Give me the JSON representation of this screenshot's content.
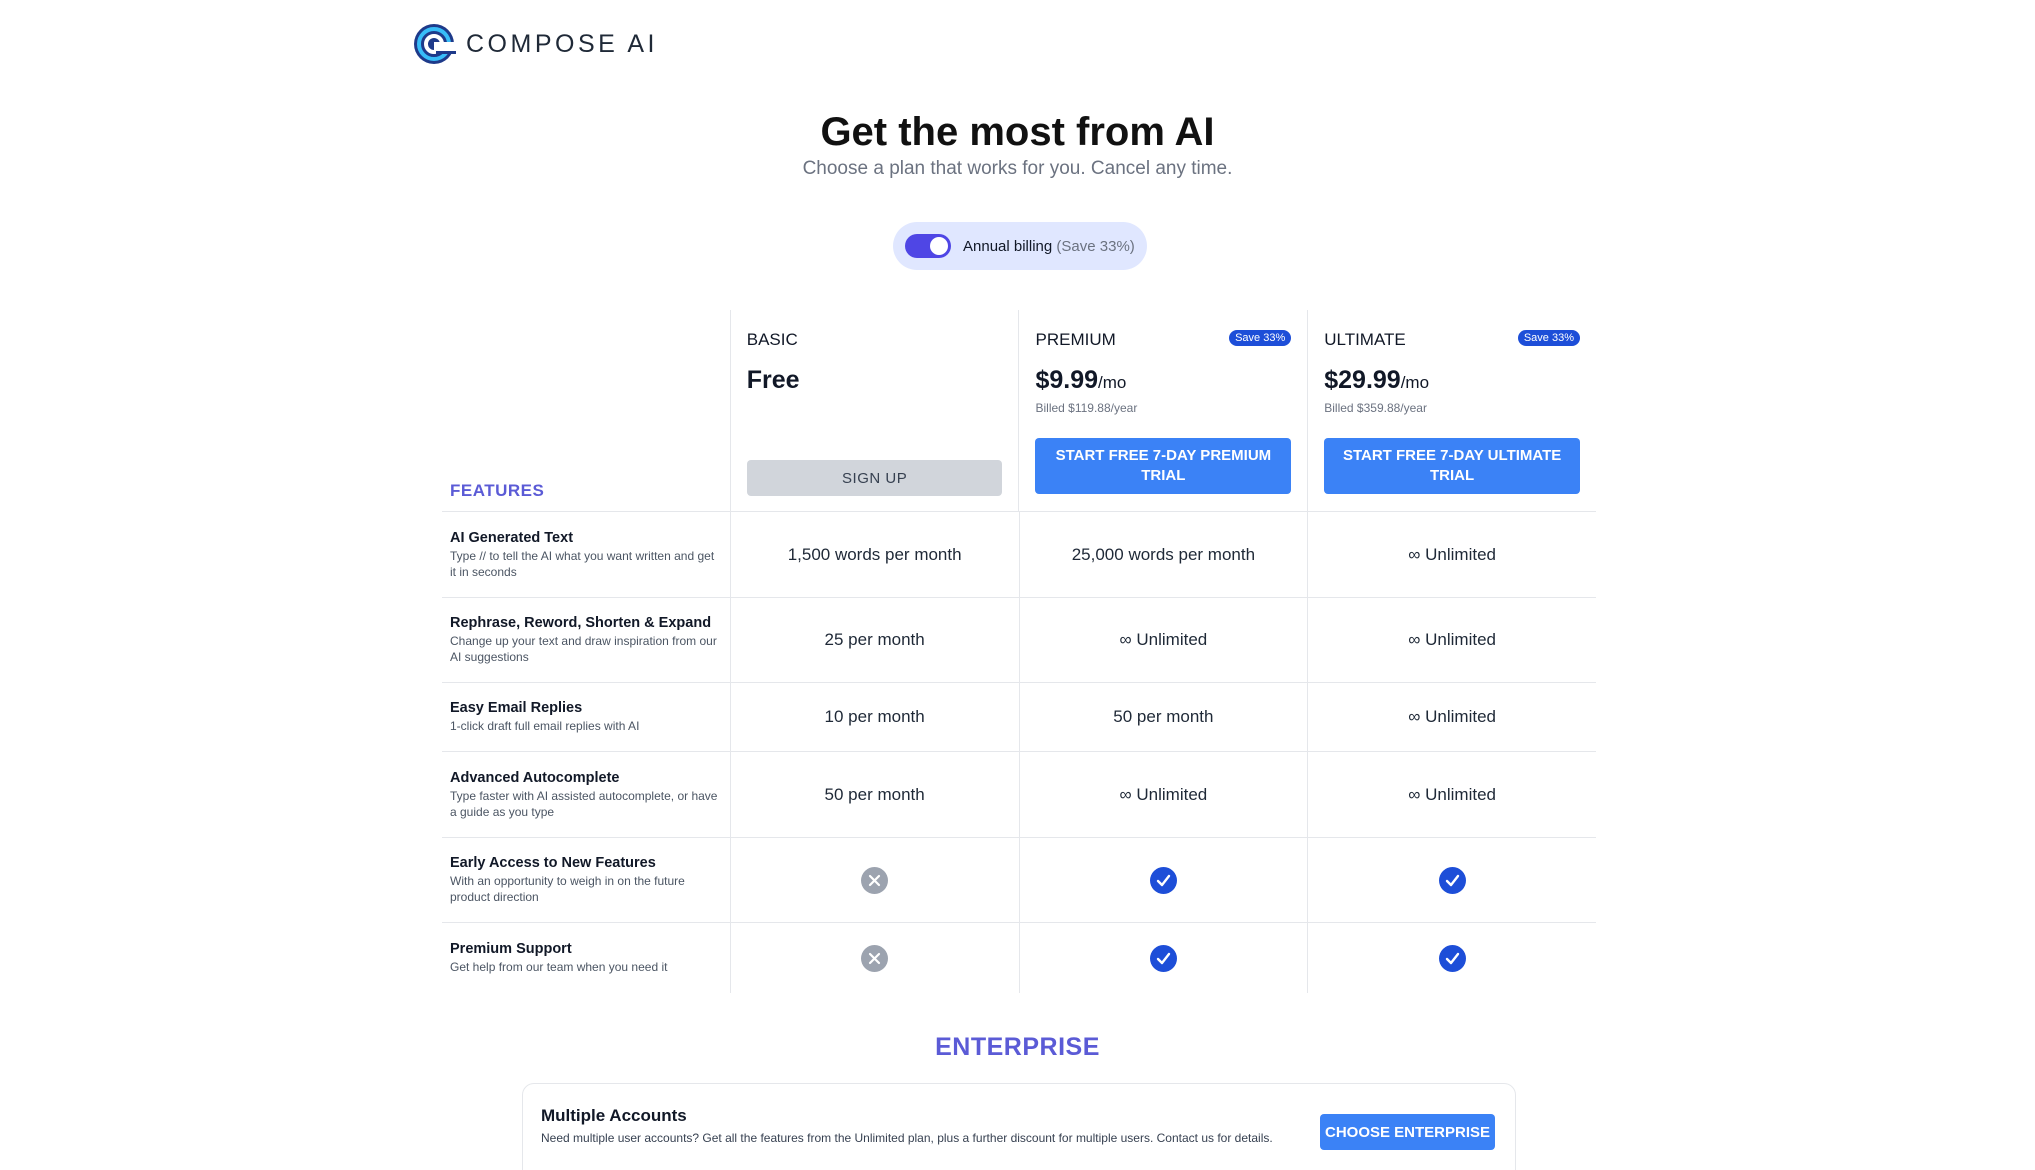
{
  "brand": {
    "name": "COMPOSE AI",
    "logo_icon": "compose-ai-logo-icon"
  },
  "hero": {
    "title": "Get the most from AI",
    "subtitle": "Choose a plan that works for you. Cancel any time."
  },
  "billing": {
    "label": "Annual billing",
    "save": "(Save 33%)",
    "enabled": true
  },
  "features_label": "FEATURES",
  "plans": [
    {
      "name": "BASIC",
      "price": "Free",
      "per": "",
      "billed": "",
      "badge": "",
      "cta": "SIGN UP"
    },
    {
      "name": "PREMIUM",
      "price": "$9.99",
      "per": "/mo",
      "billed": "Billed $119.88/year",
      "badge": "Save 33%",
      "cta": "START FREE 7-DAY PREMIUM TRIAL"
    },
    {
      "name": "ULTIMATE",
      "price": "$29.99",
      "per": "/mo",
      "billed": "Billed $359.88/year",
      "badge": "Save 33%",
      "cta": "START FREE 7-DAY ULTIMATE TRIAL"
    }
  ],
  "features": [
    {
      "title": "AI Generated Text",
      "desc": "Type // to tell the AI what you want written and get it in seconds",
      "values": [
        "1,500 words per month",
        "25,000 words per month",
        "∞ Unlimited"
      ]
    },
    {
      "title": "Rephrase, Reword, Shorten & Expand",
      "desc": "Change up your text and draw inspiration from our AI suggestions",
      "values": [
        "25 per month",
        "∞ Unlimited",
        "∞ Unlimited"
      ]
    },
    {
      "title": "Easy Email Replies",
      "desc": "1-click draft full email replies with AI",
      "values": [
        "10 per month",
        "50 per month",
        "∞ Unlimited"
      ]
    },
    {
      "title": "Advanced Autocomplete",
      "desc": "Type faster with AI assisted autocomplete, or have a guide as you type",
      "values": [
        "50 per month",
        "∞ Unlimited",
        "∞ Unlimited"
      ]
    },
    {
      "title": "Early Access to New Features",
      "desc": "With an opportunity to weigh in on the future product direction",
      "included": [
        false,
        true,
        true
      ]
    },
    {
      "title": "Premium Support",
      "desc": "Get help from our team when you need it",
      "included": [
        false,
        true,
        true
      ]
    }
  ],
  "enterprise": {
    "heading": "ENTERPRISE",
    "title": "Multiple Accounts",
    "desc": "Need multiple user accounts? Get all the features from the Unlimited plan, plus a further discount for multiple users. Contact us for details.",
    "cta": "CHOOSE ENTERPRISE"
  },
  "colors": {
    "accent": "#5b5bd6",
    "button": "#3b82f6",
    "check": "#1d4ed8",
    "toggle": "#4f46e5"
  }
}
